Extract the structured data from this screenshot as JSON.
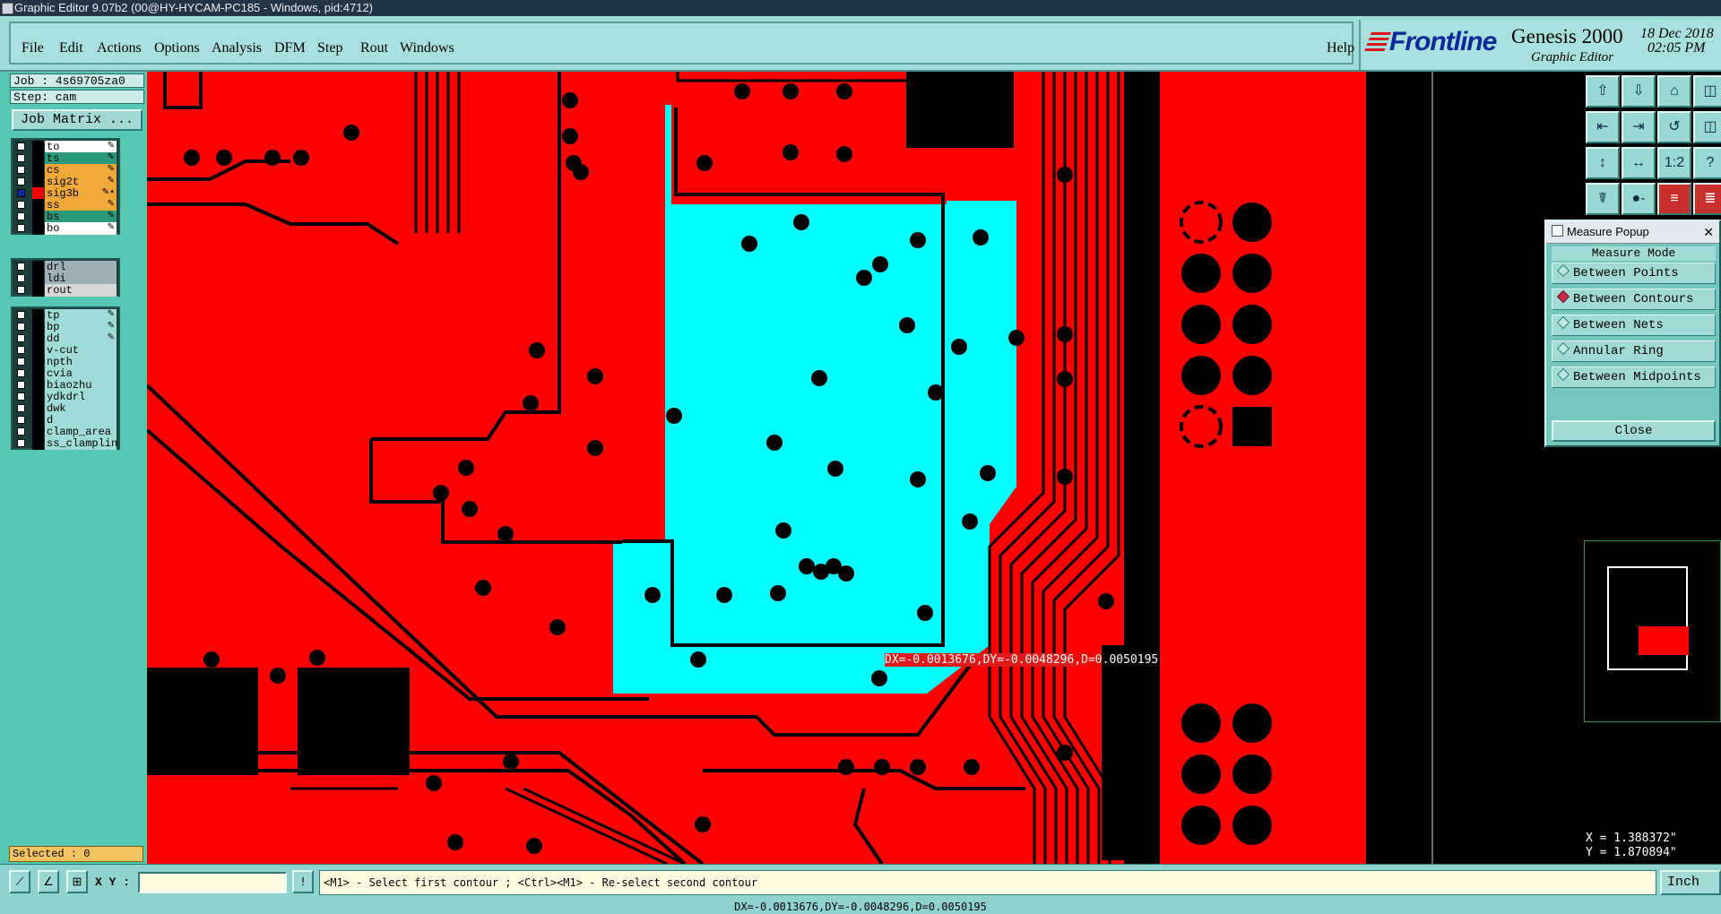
{
  "window": {
    "title": "Graphic Editor 9.07b2 (00@HY-HYCAM-PC185 - Windows, pid:4712)"
  },
  "menu": {
    "items": [
      "File",
      "Edit",
      "Actions",
      "Options",
      "Analysis",
      "DFM",
      "Step",
      "Rout",
      "Windows"
    ],
    "help": "Help"
  },
  "brand": {
    "logo": "Frontline",
    "product": "Genesis 2000",
    "subtitle": "Graphic Editor",
    "date": "18 Dec 2018",
    "time": "02:05 PM"
  },
  "job": {
    "job_label": "Job : 4s69705za0",
    "step_label": "Step: cam",
    "matrix_button": "Job Matrix ..."
  },
  "layers": {
    "group1": [
      {
        "name": "to",
        "color": "#ffffff",
        "checked": false,
        "flag": "✎"
      },
      {
        "name": "ts",
        "color": "#2a9a7a",
        "checked": false,
        "flag": "✎"
      },
      {
        "name": "cs",
        "color": "#f0a838",
        "checked": false,
        "flag": "✎"
      },
      {
        "name": "sig2t",
        "color": "#f0a838",
        "checked": false,
        "flag": "✎"
      },
      {
        "name": "sig3b",
        "color": "#f0a838",
        "checked": true,
        "flag": "✎▪"
      },
      {
        "name": "ss",
        "color": "#f0a838",
        "checked": false,
        "flag": "✎"
      },
      {
        "name": "bs",
        "color": "#2a9a7a",
        "checked": false,
        "flag": "✎"
      },
      {
        "name": "bo",
        "color": "#ffffff",
        "checked": false,
        "flag": "✎"
      }
    ],
    "group2": [
      {
        "name": "drl",
        "color": "#9fb0b8",
        "checked": false,
        "flag": ""
      },
      {
        "name": "ldi",
        "color": "#9fb0b8",
        "checked": false,
        "flag": ""
      },
      {
        "name": "rout",
        "color": "#d8d8d8",
        "checked": false,
        "flag": ""
      }
    ],
    "group3": [
      {
        "name": "tp",
        "color": "#9fdcd8",
        "checked": false,
        "flag": "✎"
      },
      {
        "name": "bp",
        "color": "#9fdcd8",
        "checked": false,
        "flag": "✎"
      },
      {
        "name": "dd",
        "color": "#9fdcd8",
        "checked": false,
        "flag": "✎"
      },
      {
        "name": "v-cut",
        "color": "#9fdcd8",
        "checked": false,
        "flag": ""
      },
      {
        "name": "npth",
        "color": "#9fdcd8",
        "checked": false,
        "flag": ""
      },
      {
        "name": "cvia",
        "color": "#9fdcd8",
        "checked": false,
        "flag": ""
      },
      {
        "name": "biaozhu",
        "color": "#9fdcd8",
        "checked": false,
        "flag": ""
      },
      {
        "name": "ydkdrl",
        "color": "#9fdcd8",
        "checked": false,
        "flag": ""
      },
      {
        "name": "dwk",
        "color": "#9fdcd8",
        "checked": false,
        "flag": ""
      },
      {
        "name": "d",
        "color": "#9fdcd8",
        "checked": false,
        "flag": ""
      },
      {
        "name": "clamp_area",
        "color": "#9fdcd8",
        "checked": false,
        "flag": ""
      },
      {
        "name": "ss_clampline",
        "color": "#9fdcd8",
        "checked": false,
        "flag": ""
      }
    ]
  },
  "selected": "Selected : 0",
  "measure": {
    "label_dx_dy": "DX=-0.0013676,DY=-0.0048296",
    "label_d": ",D=0.0050195"
  },
  "toolbar_icons": [
    "layer-up-icon",
    "layer-down-icon",
    "home-icon",
    "window-icon",
    "prev-icon",
    "next-icon",
    "undo-icon",
    "split-icon",
    "zoom-fit-icon",
    "zoom-center-icon",
    "scale-icon",
    "help-icon",
    "snap-icon",
    "measure-icon",
    "net-icon",
    "net-select-icon"
  ],
  "toolbar_glyphs": [
    "⇧",
    "⇩",
    "⌂",
    "◫",
    "⇤",
    "⇥",
    "↺",
    "◫",
    "↕",
    "↔",
    "1:2",
    "?",
    "☤",
    "●-",
    "≡",
    "≣"
  ],
  "popup": {
    "title": "Measure Popup",
    "mode_header": "Measure Mode",
    "options": [
      "Between Points",
      "Between Contours",
      "Between Nets",
      "Annular Ring",
      "Between Midpoints"
    ],
    "selected_option": "Between Contours",
    "close": "Close"
  },
  "coords": {
    "x": "X = 1.388372\"",
    "y": "Y = 1.870894\""
  },
  "bottom": {
    "xy_label": "X Y :",
    "xy_value": "",
    "prompt": "<M1> - Select first contour ; <Ctrl><M1> - Re-select second contour",
    "units": "Inch",
    "status": "DX=-0.0013676,DY=-0.0048296,D=0.0050195"
  }
}
